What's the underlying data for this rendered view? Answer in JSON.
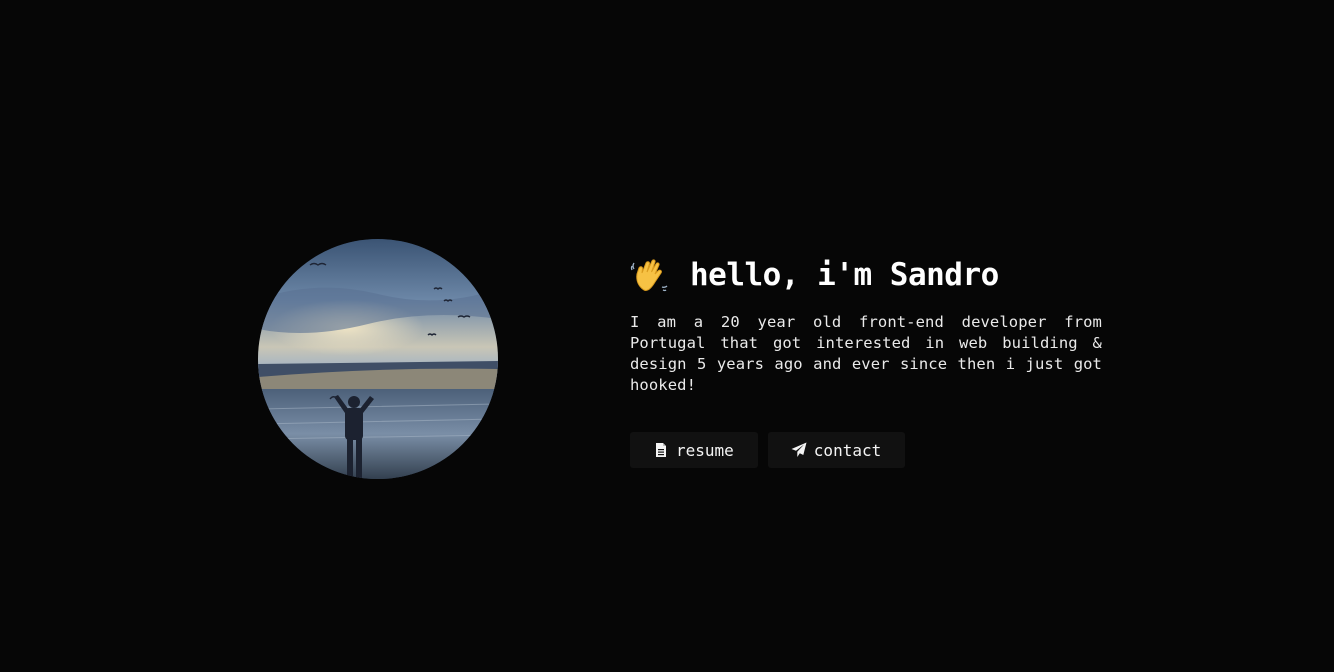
{
  "hero": {
    "greeting": "hello, i'm Sandro",
    "wave_icon": "waving-hand-icon",
    "intro": "I am a 20 year old front-end developer from Portugal that got interested in web building & design 5 years ago and ever since then i just got hooked!",
    "avatar": "profile-photo"
  },
  "buttons": {
    "resume_label": "resume",
    "resume_icon": "document-icon",
    "contact_label": "contact",
    "contact_icon": "paper-plane-icon"
  },
  "colors": {
    "background": "#060606",
    "text": "#f2f2f2",
    "button_background": "#111111"
  }
}
